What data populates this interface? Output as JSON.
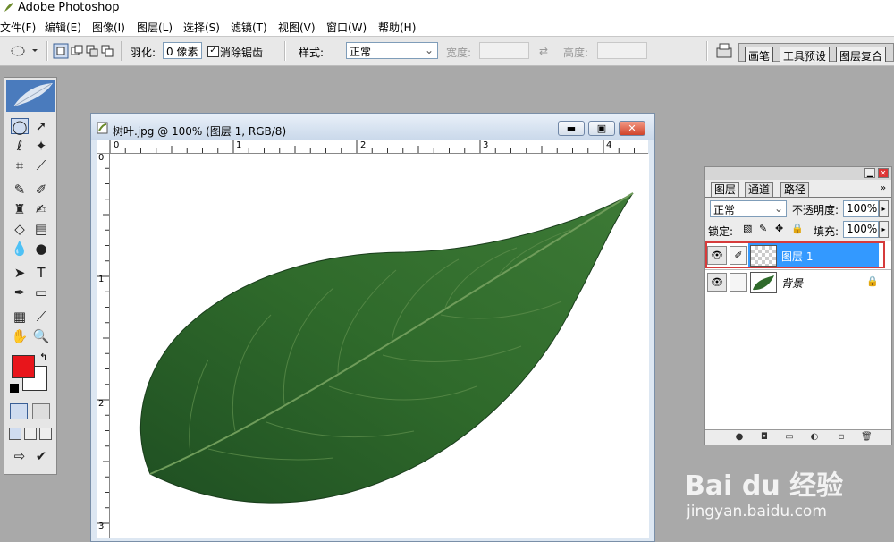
{
  "app": {
    "title": "Adobe Photoshop"
  },
  "menu": [
    "文件(F)",
    "编辑(E)",
    "图像(I)",
    "图层(L)",
    "选择(S)",
    "滤镜(T)",
    "视图(V)",
    "窗口(W)",
    "帮助(H)"
  ],
  "options": {
    "feather_label": "羽化:",
    "feather_value": "0 像素",
    "antialias_label": "消除锯齿",
    "style_label": "样式:",
    "style_value": "正常",
    "width_label": "宽度:",
    "height_label": "高度:",
    "palette_tabs": [
      "画笔",
      "工具预设",
      "图层复合"
    ]
  },
  "document": {
    "title": "树叶.jpg @ 100% (图层 1, RGB/8)",
    "ruler_top": [
      "0",
      "1",
      "2",
      "3",
      "4"
    ],
    "ruler_left": [
      "0",
      "1",
      "2",
      "3"
    ]
  },
  "layers_panel": {
    "tabs": [
      "图层",
      "通道",
      "路径"
    ],
    "blend_mode": "正常",
    "opacity_label": "不透明度:",
    "opacity_value": "100%",
    "lock_label": "锁定:",
    "fill_label": "填充:",
    "fill_value": "100%",
    "layers": [
      {
        "name": "图层 1",
        "selected": true
      },
      {
        "name": "背景",
        "selected": false
      }
    ]
  },
  "colors": {
    "foreground": "#e8151b",
    "background": "#ffffff",
    "selection_highlight": "#3399ff",
    "annotation_box": "#d63b3b"
  },
  "watermark": {
    "logo": "Bai du 经验",
    "url": "jingyan.baidu.com"
  }
}
